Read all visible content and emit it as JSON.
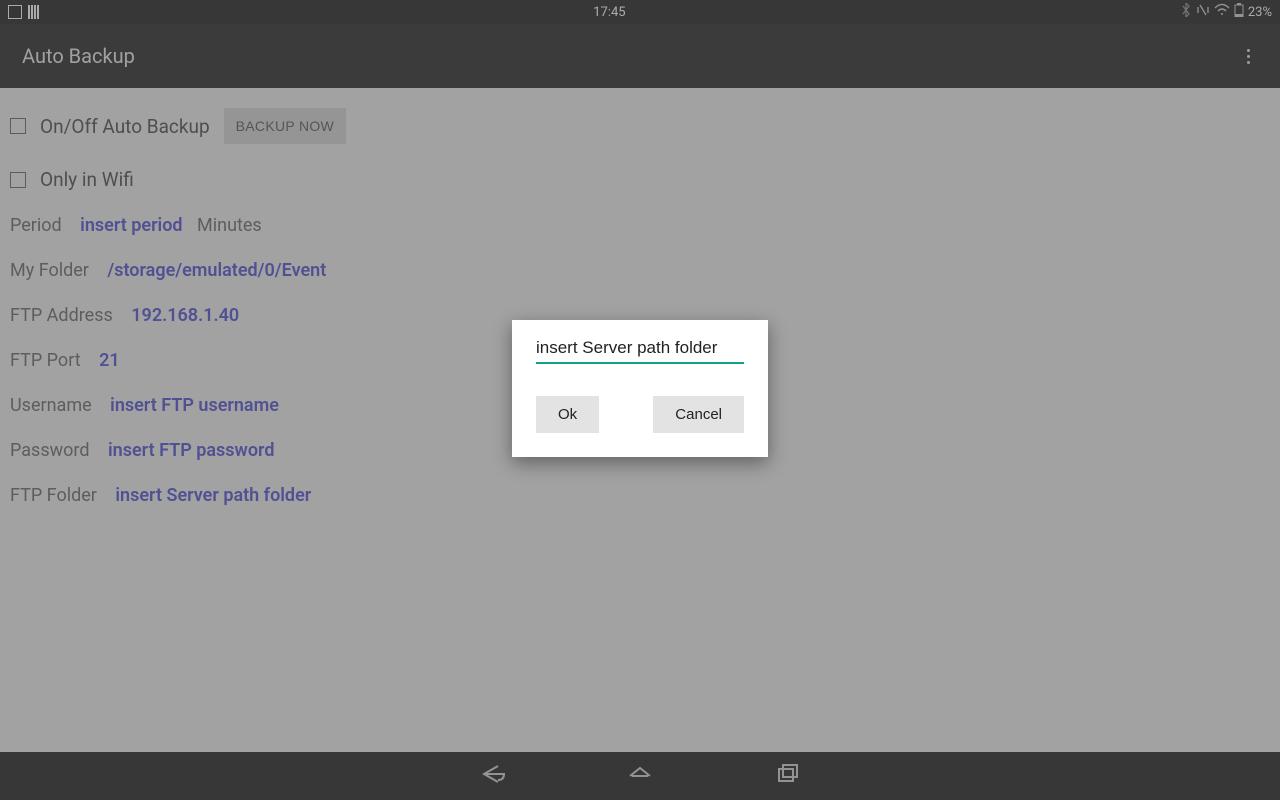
{
  "statusBar": {
    "time": "17:45",
    "battery": "23%"
  },
  "appBar": {
    "title": "Auto Backup"
  },
  "settings": {
    "autoBackupLabel": "On/Off Auto Backup",
    "backupNowLabel": "BACKUP NOW",
    "onlyWifiLabel": "Only in Wifi",
    "periodLabel": "Period",
    "periodValue": "insert period",
    "periodUnit": "Minutes",
    "myFolderLabel": "My Folder",
    "myFolderValue": "/storage/emulated/0/Event",
    "ftpAddressLabel": "FTP Address",
    "ftpAddressValue": "192.168.1.40",
    "ftpPortLabel": "FTP Port",
    "ftpPortValue": "21",
    "usernameLabel": "Username",
    "usernameValue": "insert FTP username",
    "passwordLabel": "Password",
    "passwordValue": "insert FTP password",
    "ftpFolderLabel": "FTP Folder",
    "ftpFolderValue": "insert Server path folder"
  },
  "dialog": {
    "inputValue": "insert Server path folder",
    "okLabel": "Ok",
    "cancelLabel": "Cancel"
  }
}
